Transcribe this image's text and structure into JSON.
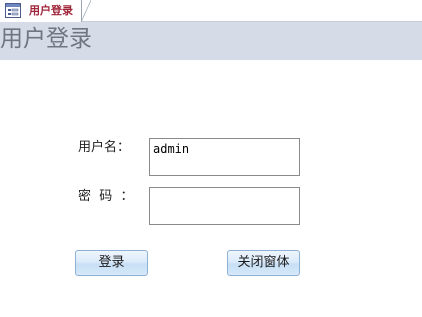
{
  "tab": {
    "label": "用户登录",
    "icon": "form-icon"
  },
  "header": {
    "title": "用户登录"
  },
  "form": {
    "username_label": "用户名：",
    "username_value": "admin",
    "password_label": "密  码  ：",
    "password_value": ""
  },
  "buttons": {
    "login_label": "登录",
    "close_label": "关闭窗体"
  },
  "colors": {
    "tab_text": "#a0263a",
    "header_bg": "#d5dce7",
    "button_border": "#8eb0d4"
  }
}
